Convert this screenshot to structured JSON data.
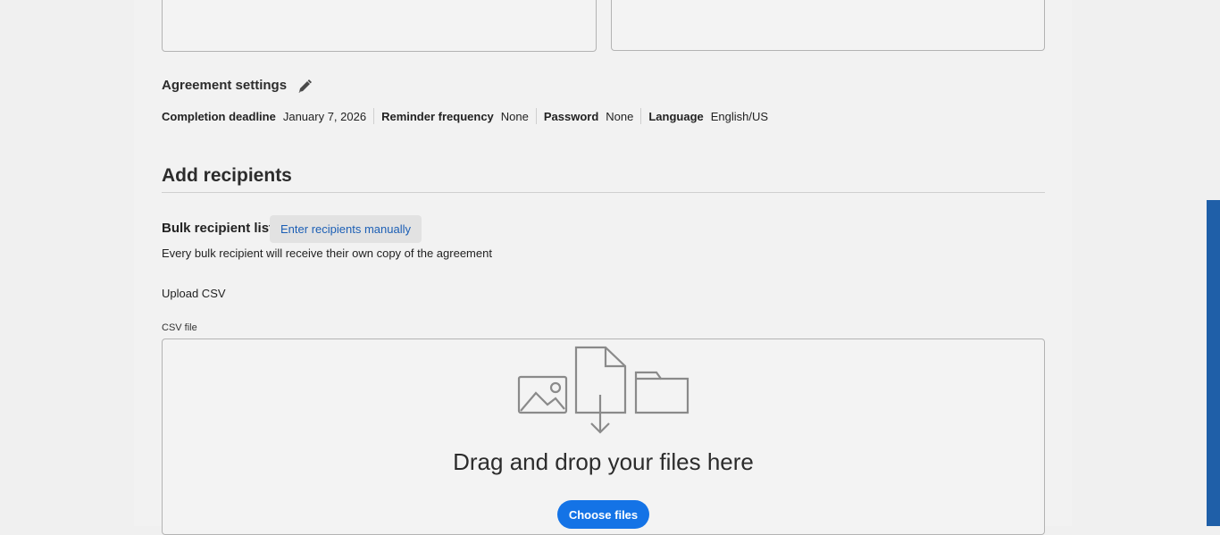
{
  "settings": {
    "title": "Agreement settings",
    "edit_icon": "pencil-icon",
    "items": [
      {
        "key": "Completion deadline",
        "value": "January 7, 2026"
      },
      {
        "key": "Reminder frequency",
        "value": "None"
      },
      {
        "key": "Password",
        "value": "None"
      },
      {
        "key": "Language",
        "value": "English/US"
      }
    ]
  },
  "recipients": {
    "title": "Add recipients",
    "bulk_label": "Bulk recipient list",
    "manual_button": "Enter recipients manually",
    "description": "Every bulk recipient will receive their own copy of the agreement",
    "upload_label": "Upload CSV",
    "csv_field_label": "CSV file",
    "dropzone": {
      "icon": "upload-files-illustration-icon",
      "text": "Drag and drop your files here",
      "choose_button": "Choose files"
    }
  },
  "colors": {
    "accent": "#1473e6",
    "link": "#1c5fb5",
    "scrollbar": "#1f5fa8"
  }
}
